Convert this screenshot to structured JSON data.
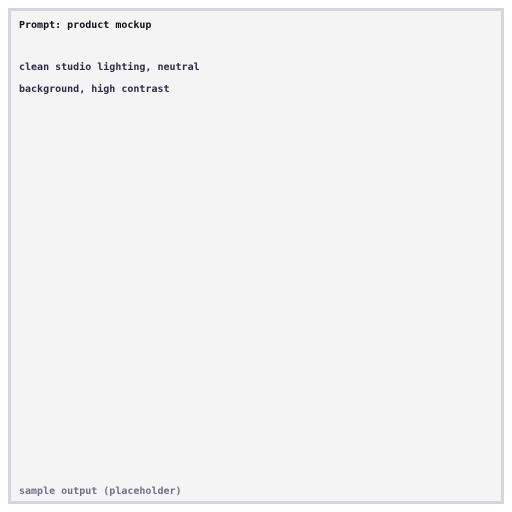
{
  "panel": {
    "title": "Prompt: product mockup",
    "prompt_lines": [
      "clean studio lighting, neutral",
      "background, high contrast"
    ],
    "caption": "sample output (placeholder)"
  },
  "colors": {
    "border": "#d4d5df",
    "background": "#f4f4f5",
    "title_text": "#101018",
    "body_text": "#2a2c44",
    "caption_text": "#6c7088"
  }
}
